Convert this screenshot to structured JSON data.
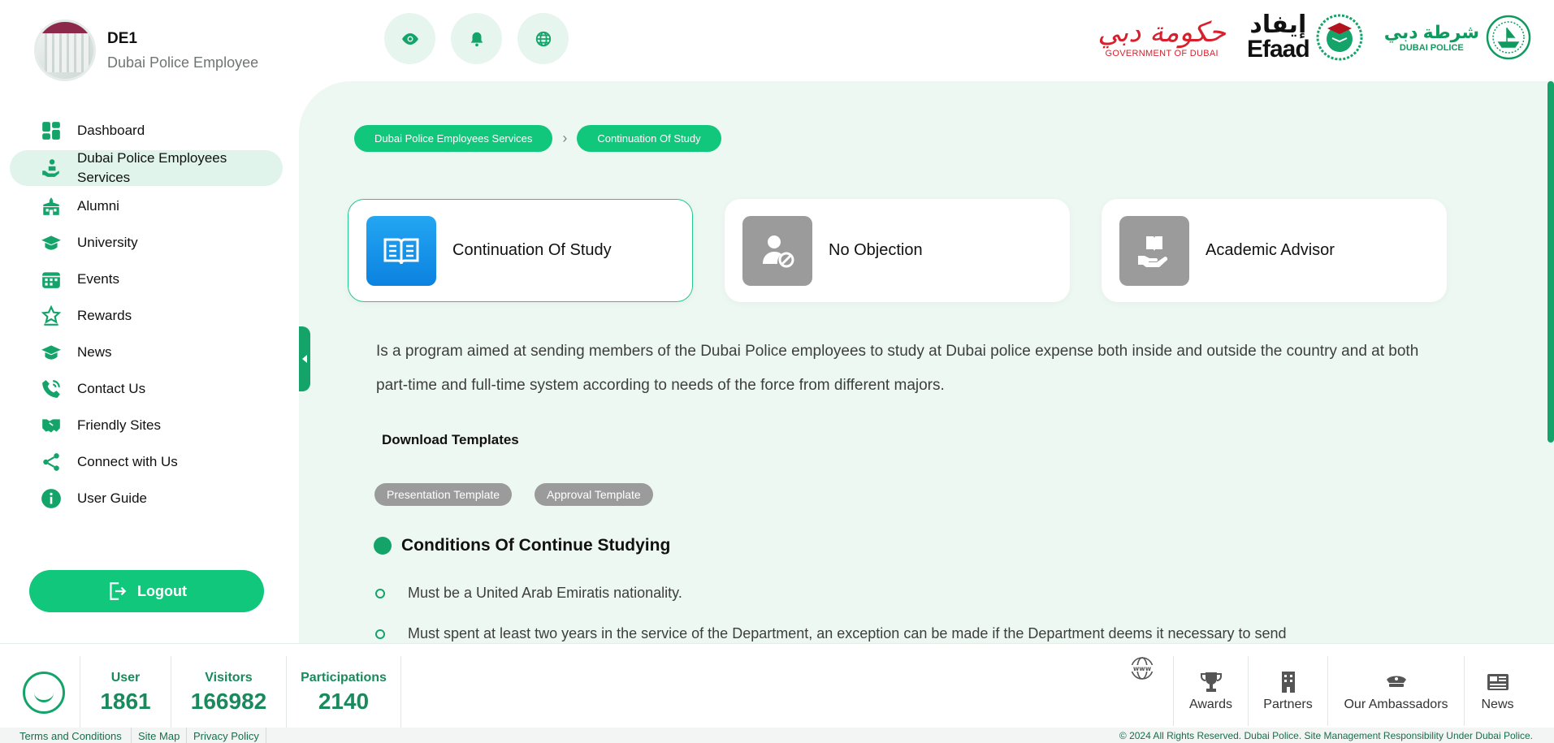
{
  "profile": {
    "name": "DE1",
    "role": "Dubai Police Employee"
  },
  "sidebar": {
    "items": [
      {
        "label": "Dashboard",
        "icon": "dashboard-icon"
      },
      {
        "label": "Dubai Police Employees Services",
        "icon": "employee-services-icon",
        "active": true
      },
      {
        "label": "Alumni",
        "icon": "alumni-icon"
      },
      {
        "label": "University",
        "icon": "graduation-cap-icon"
      },
      {
        "label": "Events",
        "icon": "calendar-icon"
      },
      {
        "label": "Rewards",
        "icon": "rewards-icon"
      },
      {
        "label": "News",
        "icon": "news-cap-icon"
      },
      {
        "label": "Contact Us",
        "icon": "phone-icon"
      },
      {
        "label": "Friendly Sites",
        "icon": "handshake-icon"
      },
      {
        "label": "Connect with Us",
        "icon": "share-icon"
      },
      {
        "label": "User Guide",
        "icon": "info-icon"
      }
    ],
    "logout_label": "Logout"
  },
  "toolbar": {
    "icons": [
      "eye-icon",
      "bell-icon",
      "globe-icon"
    ]
  },
  "logos": {
    "gov_ar": "حكومة دبي",
    "gov_en": "GOVERNMENT OF DUBAI",
    "efaad_ar": "إيفاد",
    "efaad_en": "Efaad",
    "dp_ar": "شرطة دبي",
    "dp_en": "DUBAI POLICE"
  },
  "breadcrumb": [
    "Dubai Police Employees Services",
    "Continuation Of Study"
  ],
  "cards": [
    {
      "title": "Continuation Of Study",
      "icon": "book-icon",
      "active": true
    },
    {
      "title": "No Objection",
      "icon": "user-block-icon",
      "active": false
    },
    {
      "title": "Academic Advisor",
      "icon": "hand-book-icon",
      "active": false
    }
  ],
  "description": "Is a program aimed at sending members of the Dubai Police employees to study at Dubai police expense both inside and outside the country and at both part-time and full-time system according to needs of the force from different majors.",
  "downloads": {
    "title": "Download Templates",
    "templates": [
      "Presentation Template",
      "Approval Template"
    ]
  },
  "conditions": {
    "title": "Conditions Of Continue Studying",
    "items": [
      "Must be a United Arab Emiratis nationality.",
      "Must spent at least two years in the service of the Department, an exception can be made if the Department deems it necessary to send"
    ]
  },
  "footer": {
    "stats": [
      {
        "label": "User",
        "value": "1861"
      },
      {
        "label": "Visitors",
        "value": "166982"
      },
      {
        "label": "Participations",
        "value": "2140"
      }
    ],
    "nav": [
      {
        "label": "",
        "icon": "www-icon"
      },
      {
        "label": "Awards",
        "icon": "trophy-icon"
      },
      {
        "label": "Partners",
        "icon": "building-icon"
      },
      {
        "label": "Our Ambassadors",
        "icon": "police-cap-icon"
      },
      {
        "label": "News",
        "icon": "newspaper-icon"
      }
    ],
    "links": [
      "Terms and Conditions",
      "Site Map",
      "Privacy Policy"
    ],
    "copyright": "© 2024 All Rights Reserved. Dubai Police. Site Management Responsibility Under Dubai Police."
  },
  "colors": {
    "accent": "#10c77c",
    "accent_dark": "#14a46a",
    "panel_bg": "#eef8f3",
    "active_card_icon": "#0b82e0",
    "inactive_icon": "#9b9b9b"
  }
}
